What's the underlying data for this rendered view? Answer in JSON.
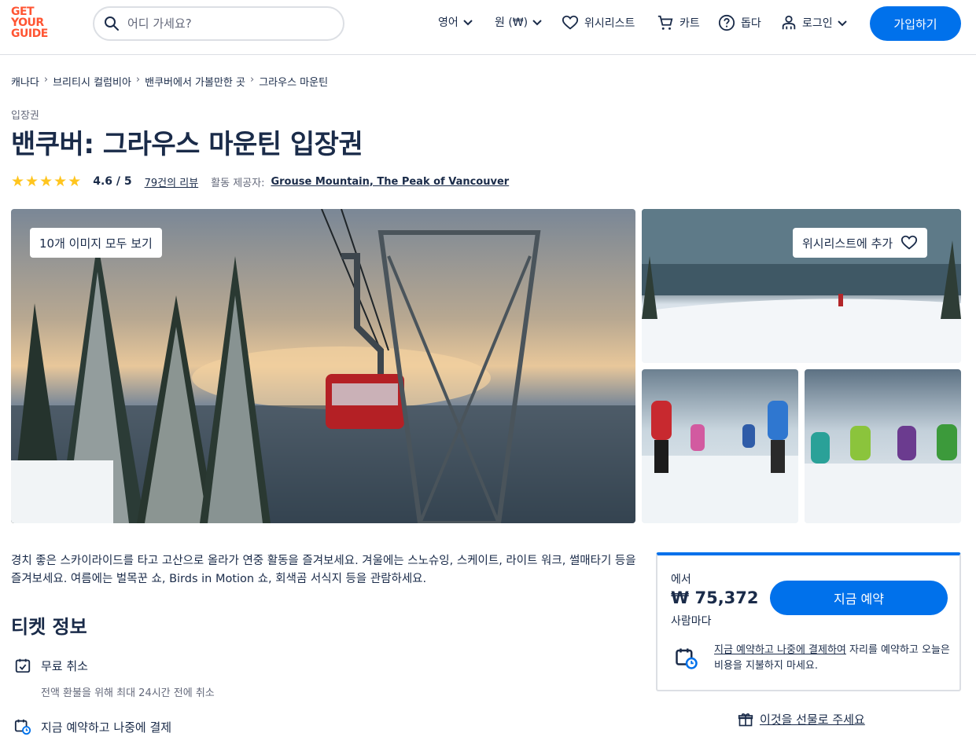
{
  "header": {
    "logo": [
      "GET",
      "YOUR",
      "GUIDE"
    ],
    "search_placeholder": "어디 가세요?",
    "language": "영어",
    "currency": "원 (₩)",
    "wishlist": "위시리스트",
    "cart": "카트",
    "help": "돕다",
    "login": "로그인",
    "signup": "가입하기"
  },
  "breadcrumb": [
    "캐나다",
    "브리티시 컬럼비아",
    "밴쿠버에서 가볼만한 곳",
    "그라우스 마운틴"
  ],
  "category": "입장권",
  "title": "밴쿠버: 그라우스 마운틴 입장권",
  "rating": {
    "stars": 5,
    "value": "4.6 / 5",
    "reviews": "79건의 리뷰",
    "provider_label": "활동 제공자:",
    "provider": "Grouse Mountain, The Peak of Vancouver"
  },
  "gallery": {
    "view_all": "10개 이미지 모두 보기",
    "add_wishlist": "위시리스트에 추가"
  },
  "description": "경치 좋은 스카이라이드를 타고 고산으로 올라가 연중 활동을 즐겨보세요. 겨울에는 스노슈잉, 스케이트, 라이트 워크, 썰매타기 등을 즐겨보세요. 여름에는 벌목꾼 쇼, Birds in Motion 쇼, 회색곰 서식지 등을 관람하세요.",
  "ticket_info": {
    "heading": "티켓 정보",
    "free_cancel": "무료 취소",
    "free_cancel_sub": "전액 환불을 위해 최대 24시간 전에 취소",
    "reserve_now": "지금 예약하고 나중에 결제"
  },
  "booking": {
    "from": "에서",
    "price": "₩ 75,372",
    "per": "사람마다",
    "book_button": "지금 예약",
    "note_link": "지금 예약하고 나중에 결제하여",
    "note_rest": " 자리를 예약하고 오늘은 비용을 지불하지 마세요.",
    "gift": "이것을 선물로 주세요"
  }
}
